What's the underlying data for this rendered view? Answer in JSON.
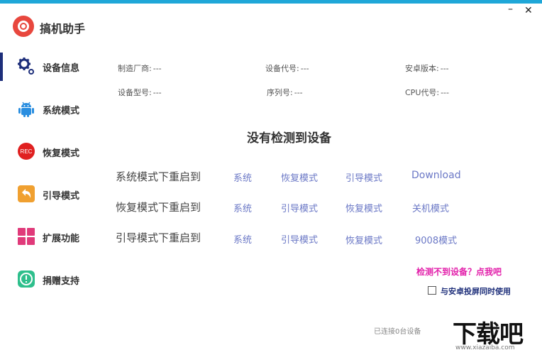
{
  "app": {
    "title": "搞机助手",
    "minimize_glyph": "–",
    "close_glyph": "✕"
  },
  "sidebar": {
    "items": [
      {
        "label": "设备信息",
        "icon": "gear-icon",
        "active": true
      },
      {
        "label": "系统模式",
        "icon": "android-icon",
        "active": false
      },
      {
        "label": "恢复模式",
        "icon": "rec-icon",
        "active": false
      },
      {
        "label": "引导模式",
        "icon": "back-arrow-icon",
        "active": false
      },
      {
        "label": "扩展功能",
        "icon": "grid-icon",
        "active": false
      },
      {
        "label": "捐赠支持",
        "icon": "alert-icon",
        "active": false
      }
    ],
    "rec_icon_text": "REC"
  },
  "device_info": {
    "manufacturer_label": "制造厂商:",
    "manufacturer_value": "---",
    "device_code_label": "设备代号:",
    "device_code_value": "---",
    "android_version_label": "安卓版本:",
    "android_version_value": "---",
    "model_label": "设备型号:",
    "model_value": "---",
    "serial_label": "序列号:",
    "serial_value": "---",
    "cpu_label": "CPU代号:",
    "cpu_value": "---"
  },
  "status_title": "没有检测到设备",
  "reboot_rows": [
    {
      "label": "系统模式下重启到",
      "options": [
        "系统",
        "恢复模式",
        "引导模式",
        "Download"
      ]
    },
    {
      "label": "恢复模式下重启到",
      "options": [
        "系统",
        "引导模式",
        "恢复模式",
        "关机模式"
      ]
    },
    {
      "label": "引导模式下重启到",
      "options": [
        "系统",
        "引导模式",
        "恢复模式",
        "9008模式"
      ]
    }
  ],
  "detect_link": "检测不到设备？点我吧",
  "mirror_option": "与安卓投屏同时使用",
  "connected_status": "已连接0台设备",
  "watermark": {
    "text": "下载吧",
    "url": "www.xiazaiba.com"
  },
  "colors": {
    "top_bar": "#1fa7d8",
    "active_indicator": "#1d2e7a",
    "link": "#6b78c6",
    "detect_link": "#e21faa",
    "android": "#2a8ee0",
    "rec": "#e02020",
    "boot": "#f0a030",
    "grid": "#e03a7a",
    "donate": "#2ebf8c"
  }
}
